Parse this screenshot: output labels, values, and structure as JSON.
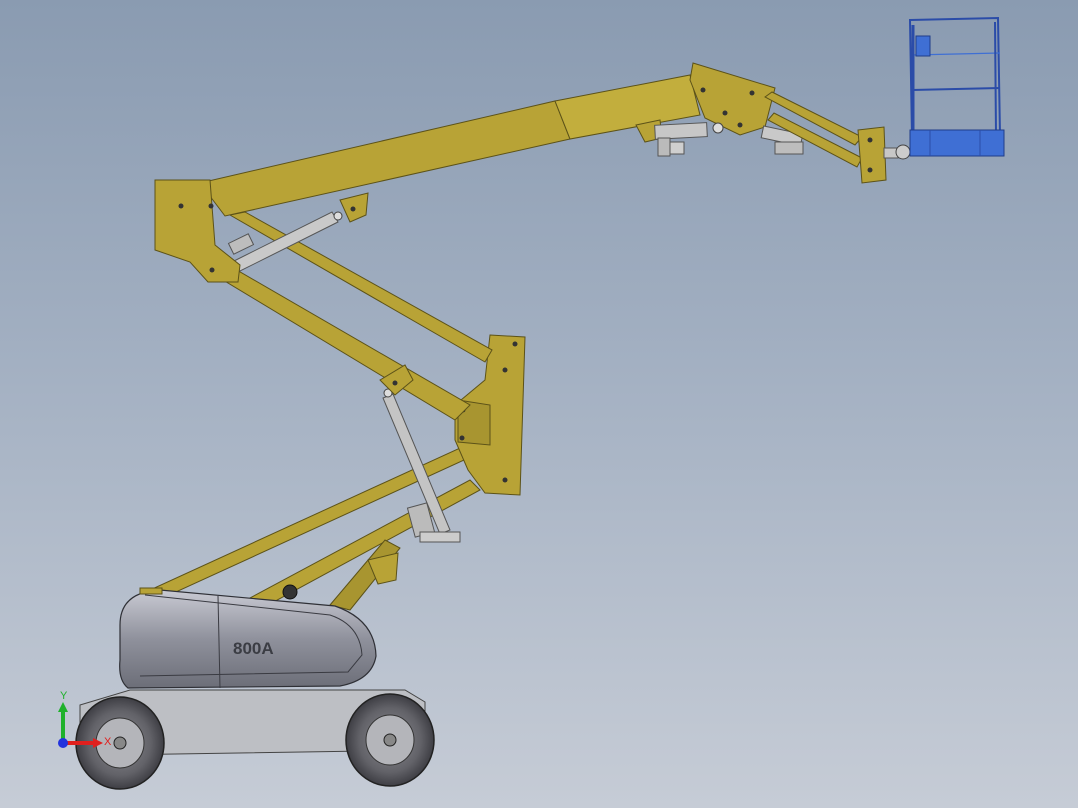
{
  "model": {
    "label": "800A",
    "colors": {
      "boom": "#b8a336",
      "boom_dark": "#8c7b22",
      "platform": "#3f6fd4",
      "chassis": "#8f919c",
      "tire": "#4a4a4e",
      "background_top": "#8a9bb1",
      "background_bottom": "#c6ccd6"
    }
  },
  "triad": {
    "x_label": "X",
    "y_label": "Y",
    "colors": {
      "x": "#e0201e",
      "y": "#1fb12b",
      "z": "#2233dd"
    }
  }
}
